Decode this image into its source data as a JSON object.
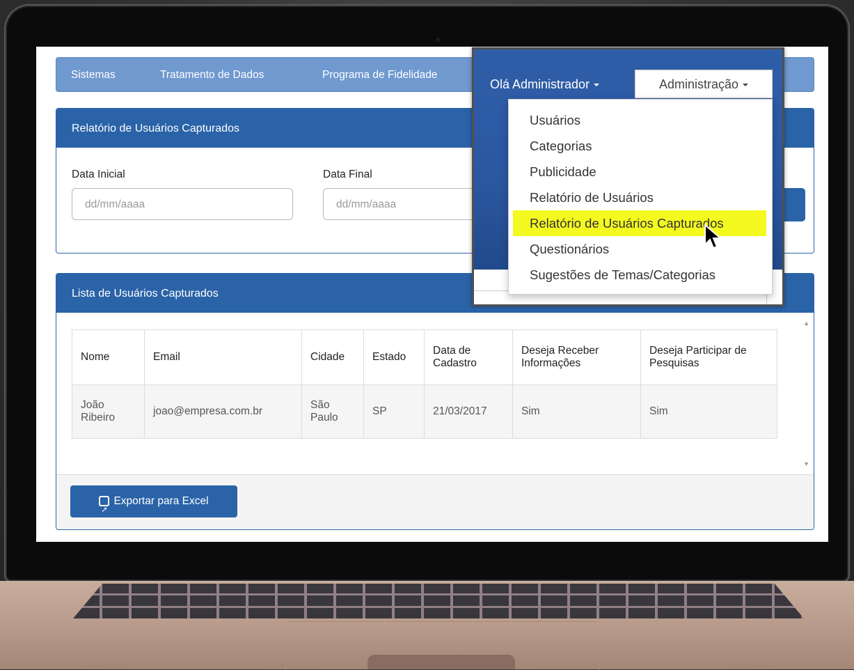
{
  "navbar": {
    "items": [
      "Sistemas",
      "Tratamento de Dados",
      "Programa de Fidelidade"
    ]
  },
  "filter_panel": {
    "title": "Relatório de Usuários Capturados",
    "start_label": "Data Inicial",
    "start_placeholder": "dd/mm/aaaa",
    "end_label": "Data Final",
    "end_placeholder": "dd/mm/aaaa"
  },
  "list_panel": {
    "title": "Lista de Usuários Capturados",
    "columns": [
      "Nome",
      "Email",
      "Cidade",
      "Estado",
      "Data de Cadastro",
      "Deseja Receber Informações",
      "Deseja Participar de Pesquisas"
    ],
    "rows": [
      {
        "nome": "João Ribeiro",
        "email": "joao@empresa.com.br",
        "cidade": "São Paulo",
        "estado": "SP",
        "data": "21/03/2017",
        "informacoes": "Sim",
        "pesquisas": "Sim"
      }
    ],
    "export_label": "Exportar para Excel"
  },
  "user_menu": {
    "greeting": "Olá Administrador",
    "admin_label": "Administração",
    "items": [
      "Usuários",
      "Categorias",
      "Publicidade",
      "Relatório de Usuários",
      "Relatório de Usuários Capturados",
      "Questionários",
      "Sugestões de Temas/Categorias"
    ],
    "highlighted_index": 4,
    "highlight_color": "#f4f91f"
  },
  "colors": {
    "primary": "#2a63a8",
    "navbar": "#6f99cf"
  }
}
